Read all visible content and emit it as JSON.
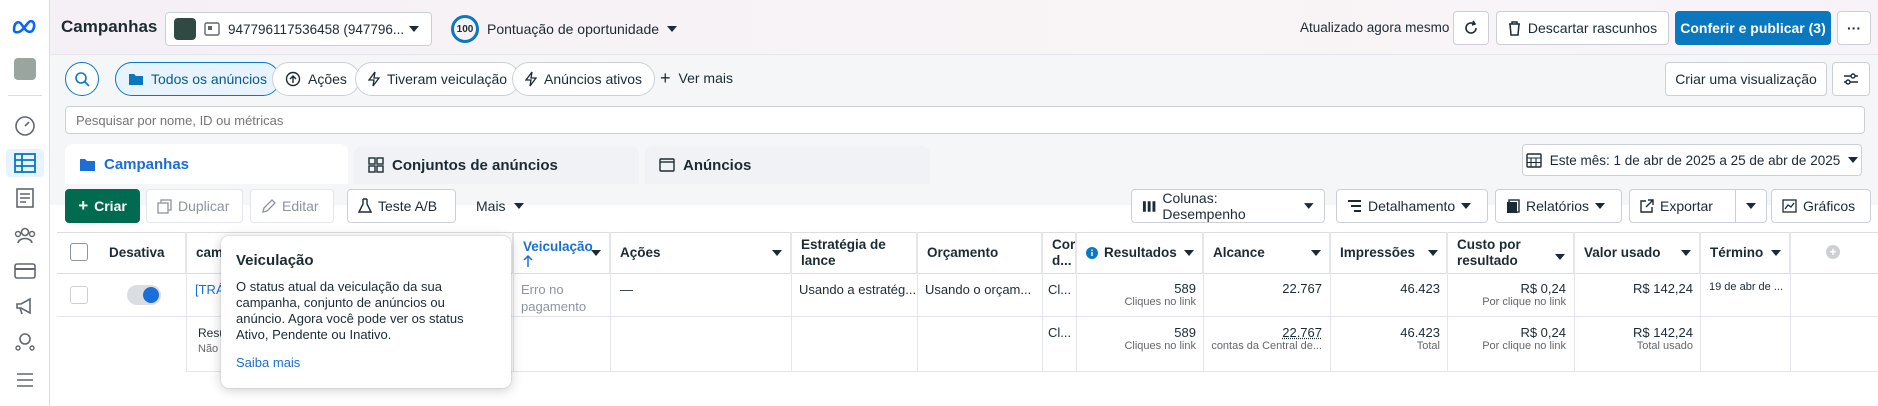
{
  "header": {
    "title": "Campanhas",
    "account": "947796117536458 (947796...",
    "score_value": "100",
    "score_label": "Pontuação de oportunidade",
    "updated": "Atualizado agora mesmo",
    "discard": "Descartar rascunhos",
    "publish": "Conferir e publicar (3)",
    "more": "···"
  },
  "filters": {
    "all_ads": "Todos os anúncios",
    "actions": "Ações",
    "had_delivery": "Tiveram veiculação",
    "active_ads": "Anúncios ativos",
    "see_more": "Ver mais",
    "create_view": "Criar uma visualização"
  },
  "search": {
    "placeholder": "Pesquisar por nome, ID ou métricas"
  },
  "tabs": [
    {
      "label": "Campanhas"
    },
    {
      "label": "Conjuntos de anúncios"
    },
    {
      "label": "Anúncios"
    }
  ],
  "date_range": "Este mês: 1 de abr de 2025 a 25 de abr de 2025",
  "toolbar": {
    "create": "Criar",
    "duplicate": "Duplicar",
    "edit": "Editar",
    "ab_test": "Teste A/B",
    "more": "Mais",
    "columns": "Colunas: Desempenho",
    "breakdown": "Detalhamento",
    "reports": "Relatórios",
    "export": "Exportar",
    "charts": "Gráficos"
  },
  "columns": {
    "deactivate": "Desativa",
    "campaign": "cam",
    "delivery": "Veiculação",
    "actions": "Ações",
    "bid_strategy_1": "Estratégia de",
    "bid_strategy_2": "lance",
    "budget": "Orçamento",
    "attribution_1": "Cor",
    "attribution_2": "d...",
    "results": "Resultados",
    "reach": "Alcance",
    "impressions": "Impressões",
    "cost_1": "Custo por",
    "cost_2": "resultado",
    "spent": "Valor usado",
    "end": "Término"
  },
  "row": {
    "name": "[TRÁ",
    "delivery_1": "Erro no",
    "delivery_2": "pagamento",
    "actions": "—",
    "bid_strategy": "Usando a estratég...",
    "budget": "Usando o orçam...",
    "attribution": "Cl...",
    "results": "589",
    "results_sub": "Cliques no link",
    "reach": "22.767",
    "impressions": "46.423",
    "cost": "R$ 0,24",
    "cost_sub": "Por clique no link",
    "spent": "R$ 142,24",
    "end": "19 de abr de ..."
  },
  "totals": {
    "label_1": "Resu",
    "label_2": "Não",
    "attribution": "Cl...",
    "results": "589",
    "results_sub": "Cliques no link",
    "reach": "22.767",
    "reach_sub": "contas da Central de...",
    "impressions": "46.423",
    "impressions_sub": "Total",
    "cost": "R$ 0,24",
    "cost_sub": "Por clique no link",
    "spent": "R$ 142,24",
    "spent_sub": "Total usado"
  },
  "tooltip": {
    "title": "Veiculação",
    "body": "O status atual da veiculação da sua campanha, conjunto de anúncios ou anúncio. Agora você pode ver os status Ativo, Pendente ou Inativo.",
    "link": "Saiba mais"
  },
  "colors": {
    "primary": "#0a78be",
    "create_green": "#006b4f",
    "tab_blue": "#1a6ed8"
  }
}
